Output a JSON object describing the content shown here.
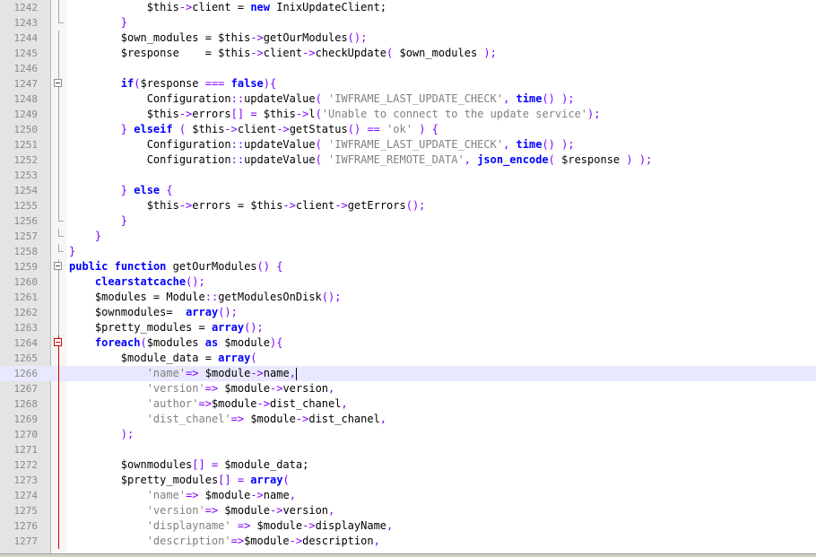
{
  "editor": {
    "current_line": "1266",
    "lines": [
      {
        "n": "1242",
        "fold": "line",
        "code": [
          [
            "            ",
            ""
          ],
          [
            "$this",
            ""
          ],
          [
            "->",
            "o"
          ],
          [
            "client = ",
            ""
          ],
          [
            "new",
            "k"
          ],
          [
            " InixUpdateClient;",
            ""
          ]
        ]
      },
      {
        "n": "1243",
        "fold": "end",
        "code": [
          [
            "        ",
            ""
          ],
          [
            "}",
            "o"
          ]
        ]
      },
      {
        "n": "1244",
        "fold": "line",
        "code": [
          [
            "        ",
            ""
          ],
          [
            "$own_modules = $this",
            ""
          ],
          [
            "->",
            "o"
          ],
          [
            "getOurModules",
            ""
          ],
          [
            "();",
            "o"
          ]
        ]
      },
      {
        "n": "1245",
        "fold": "line",
        "code": [
          [
            "        ",
            ""
          ],
          [
            "$response    = $this",
            ""
          ],
          [
            "->",
            "o"
          ],
          [
            "client",
            ""
          ],
          [
            "->",
            "o"
          ],
          [
            "checkUpdate",
            ""
          ],
          [
            "( ",
            "o"
          ],
          [
            "$own_modules",
            ""
          ],
          [
            " );",
            "o"
          ]
        ]
      },
      {
        "n": "1246",
        "fold": "line",
        "code": [
          [
            "",
            ""
          ]
        ]
      },
      {
        "n": "1247",
        "fold": "box",
        "code": [
          [
            "        ",
            ""
          ],
          [
            "if",
            "k"
          ],
          [
            "(",
            "o"
          ],
          [
            "$response ",
            ""
          ],
          [
            "===",
            "o"
          ],
          [
            " ",
            ""
          ],
          [
            "false",
            "k"
          ],
          [
            "){",
            "o"
          ]
        ]
      },
      {
        "n": "1248",
        "fold": "line",
        "code": [
          [
            "            ",
            ""
          ],
          [
            "Configuration",
            ""
          ],
          [
            "::",
            "o"
          ],
          [
            "updateValue",
            ""
          ],
          [
            "( ",
            "o"
          ],
          [
            "'IWFRAME_LAST_UPDATE_CHECK'",
            "s"
          ],
          [
            ", ",
            "o"
          ],
          [
            "time",
            "k"
          ],
          [
            "() );",
            "o"
          ]
        ]
      },
      {
        "n": "1249",
        "fold": "line",
        "code": [
          [
            "            ",
            ""
          ],
          [
            "$this",
            ""
          ],
          [
            "->",
            "o"
          ],
          [
            "errors",
            ""
          ],
          [
            "[] = ",
            "o"
          ],
          [
            "$this",
            ""
          ],
          [
            "->",
            "o"
          ],
          [
            "l",
            ""
          ],
          [
            "(",
            "o"
          ],
          [
            "'Unable to connect to the update service'",
            "s"
          ],
          [
            ");",
            "o"
          ]
        ]
      },
      {
        "n": "1250",
        "fold": "line",
        "code": [
          [
            "        ",
            ""
          ],
          [
            "} ",
            "o"
          ],
          [
            "elseif",
            "k"
          ],
          [
            " ( ",
            "o"
          ],
          [
            "$this",
            ""
          ],
          [
            "->",
            "o"
          ],
          [
            "client",
            ""
          ],
          [
            "->",
            "o"
          ],
          [
            "getStatus",
            ""
          ],
          [
            "() == ",
            "o"
          ],
          [
            "'ok'",
            "s"
          ],
          [
            " ) {",
            "o"
          ]
        ]
      },
      {
        "n": "1251",
        "fold": "line",
        "code": [
          [
            "            ",
            ""
          ],
          [
            "Configuration",
            ""
          ],
          [
            "::",
            "o"
          ],
          [
            "updateValue",
            ""
          ],
          [
            "( ",
            "o"
          ],
          [
            "'IWFRAME_LAST_UPDATE_CHECK'",
            "s"
          ],
          [
            ", ",
            "o"
          ],
          [
            "time",
            "k"
          ],
          [
            "() );",
            "o"
          ]
        ]
      },
      {
        "n": "1252",
        "fold": "line",
        "code": [
          [
            "            ",
            ""
          ],
          [
            "Configuration",
            ""
          ],
          [
            "::",
            "o"
          ],
          [
            "updateValue",
            ""
          ],
          [
            "( ",
            "o"
          ],
          [
            "'IWFRAME_REMOTE_DATA'",
            "s"
          ],
          [
            ", ",
            "o"
          ],
          [
            "json_encode",
            "k"
          ],
          [
            "( ",
            "o"
          ],
          [
            "$response",
            ""
          ],
          [
            " ) );",
            "o"
          ]
        ]
      },
      {
        "n": "1253",
        "fold": "line",
        "code": [
          [
            "",
            ""
          ]
        ]
      },
      {
        "n": "1254",
        "fold": "line",
        "code": [
          [
            "        ",
            ""
          ],
          [
            "} ",
            "o"
          ],
          [
            "else",
            "k"
          ],
          [
            " {",
            "o"
          ]
        ]
      },
      {
        "n": "1255",
        "fold": "line",
        "code": [
          [
            "            ",
            ""
          ],
          [
            "$this",
            ""
          ],
          [
            "->",
            "o"
          ],
          [
            "errors = ",
            ""
          ],
          [
            "$this",
            ""
          ],
          [
            "->",
            "o"
          ],
          [
            "client",
            ""
          ],
          [
            "->",
            "o"
          ],
          [
            "getErrors",
            ""
          ],
          [
            "();",
            "o"
          ]
        ]
      },
      {
        "n": "1256",
        "fold": "end",
        "code": [
          [
            "        ",
            ""
          ],
          [
            "}",
            "o"
          ]
        ]
      },
      {
        "n": "1257",
        "fold": "end",
        "code": [
          [
            "    ",
            ""
          ],
          [
            "}",
            "o"
          ]
        ]
      },
      {
        "n": "1258",
        "fold": "end",
        "code": [
          [
            "",
            ""
          ],
          [
            "}",
            "o"
          ]
        ]
      },
      {
        "n": "1259",
        "fold": "box",
        "code": [
          [
            "",
            ""
          ],
          [
            "public",
            "k"
          ],
          [
            " ",
            ""
          ],
          [
            "function",
            "k"
          ],
          [
            " getOurModules",
            ""
          ],
          [
            "() {",
            "o"
          ]
        ]
      },
      {
        "n": "1260",
        "fold": "line",
        "code": [
          [
            "    ",
            ""
          ],
          [
            "clearstatcache",
            "k"
          ],
          [
            "();",
            "o"
          ]
        ]
      },
      {
        "n": "1261",
        "fold": "line",
        "code": [
          [
            "    ",
            ""
          ],
          [
            "$modules = Module",
            ""
          ],
          [
            "::",
            "o"
          ],
          [
            "getModulesOnDisk",
            ""
          ],
          [
            "();",
            "o"
          ]
        ]
      },
      {
        "n": "1262",
        "fold": "line",
        "code": [
          [
            "    ",
            ""
          ],
          [
            "$ownmodules=  ",
            ""
          ],
          [
            "array",
            "k"
          ],
          [
            "();",
            "o"
          ]
        ]
      },
      {
        "n": "1263",
        "fold": "line",
        "code": [
          [
            "    ",
            ""
          ],
          [
            "$pretty_modules = ",
            ""
          ],
          [
            "array",
            "k"
          ],
          [
            "();",
            "o"
          ]
        ]
      },
      {
        "n": "1264",
        "fold": "boxred",
        "code": [
          [
            "    ",
            ""
          ],
          [
            "foreach",
            "k"
          ],
          [
            "(",
            "o"
          ],
          [
            "$modules ",
            ""
          ],
          [
            "as",
            "k"
          ],
          [
            " $module",
            ""
          ],
          [
            "){",
            "o"
          ]
        ]
      },
      {
        "n": "1265",
        "fold": "red",
        "code": [
          [
            "        ",
            ""
          ],
          [
            "$module_data = ",
            ""
          ],
          [
            "array",
            "k"
          ],
          [
            "(",
            "o"
          ]
        ]
      },
      {
        "n": "1266",
        "fold": "red",
        "code": [
          [
            "            ",
            ""
          ],
          [
            "'name'",
            "s"
          ],
          [
            "=> ",
            "o"
          ],
          [
            "$module",
            ""
          ],
          [
            "->",
            "o"
          ],
          [
            "name",
            ""
          ],
          [
            ",",
            "o"
          ]
        ]
      },
      {
        "n": "1267",
        "fold": "red",
        "code": [
          [
            "            ",
            ""
          ],
          [
            "'version'",
            "s"
          ],
          [
            "=> ",
            "o"
          ],
          [
            "$module",
            ""
          ],
          [
            "->",
            "o"
          ],
          [
            "version",
            ""
          ],
          [
            ",",
            "o"
          ]
        ]
      },
      {
        "n": "1268",
        "fold": "red",
        "code": [
          [
            "            ",
            ""
          ],
          [
            "'author'",
            "s"
          ],
          [
            "=>",
            "o"
          ],
          [
            "$module",
            ""
          ],
          [
            "->",
            "o"
          ],
          [
            "dist_chanel",
            ""
          ],
          [
            ",",
            "o"
          ]
        ]
      },
      {
        "n": "1269",
        "fold": "red",
        "code": [
          [
            "            ",
            ""
          ],
          [
            "'dist_chanel'",
            "s"
          ],
          [
            "=> ",
            "o"
          ],
          [
            "$module",
            ""
          ],
          [
            "->",
            "o"
          ],
          [
            "dist_chanel",
            ""
          ],
          [
            ",",
            "o"
          ]
        ]
      },
      {
        "n": "1270",
        "fold": "red",
        "code": [
          [
            "        ",
            ""
          ],
          [
            ");",
            "o"
          ]
        ]
      },
      {
        "n": "1271",
        "fold": "red",
        "code": [
          [
            "",
            ""
          ]
        ]
      },
      {
        "n": "1272",
        "fold": "red",
        "code": [
          [
            "        ",
            ""
          ],
          [
            "$ownmodules",
            ""
          ],
          [
            "[] = ",
            "o"
          ],
          [
            "$module_data;",
            ""
          ]
        ]
      },
      {
        "n": "1273",
        "fold": "red",
        "code": [
          [
            "        ",
            ""
          ],
          [
            "$pretty_modules",
            ""
          ],
          [
            "[] = ",
            "o"
          ],
          [
            "array",
            "k"
          ],
          [
            "(",
            "o"
          ]
        ]
      },
      {
        "n": "1274",
        "fold": "red",
        "code": [
          [
            "            ",
            ""
          ],
          [
            "'name'",
            "s"
          ],
          [
            "=> ",
            "o"
          ],
          [
            "$module",
            ""
          ],
          [
            "->",
            "o"
          ],
          [
            "name",
            ""
          ],
          [
            ",",
            "o"
          ]
        ]
      },
      {
        "n": "1275",
        "fold": "red",
        "code": [
          [
            "            ",
            ""
          ],
          [
            "'version'",
            "s"
          ],
          [
            "=> ",
            "o"
          ],
          [
            "$module",
            ""
          ],
          [
            "->",
            "o"
          ],
          [
            "version",
            ""
          ],
          [
            ",",
            "o"
          ]
        ]
      },
      {
        "n": "1276",
        "fold": "red",
        "code": [
          [
            "            ",
            ""
          ],
          [
            "'displayname'",
            "s"
          ],
          [
            " => ",
            "o"
          ],
          [
            "$module",
            ""
          ],
          [
            "->",
            "o"
          ],
          [
            "displayName",
            ""
          ],
          [
            ",",
            "o"
          ]
        ]
      },
      {
        "n": "1277",
        "fold": "red",
        "code": [
          [
            "            ",
            ""
          ],
          [
            "'description'",
            "s"
          ],
          [
            "=>",
            "o"
          ],
          [
            "$module",
            ""
          ],
          [
            "->",
            "o"
          ],
          [
            "description",
            ""
          ],
          [
            ",",
            "o"
          ]
        ]
      }
    ]
  },
  "colors": {
    "keyword": "#0000ff",
    "operator": "#8000ff",
    "string": "#808080",
    "current_line_bg": "#e8e8ff",
    "fold_active": "#d00000"
  }
}
